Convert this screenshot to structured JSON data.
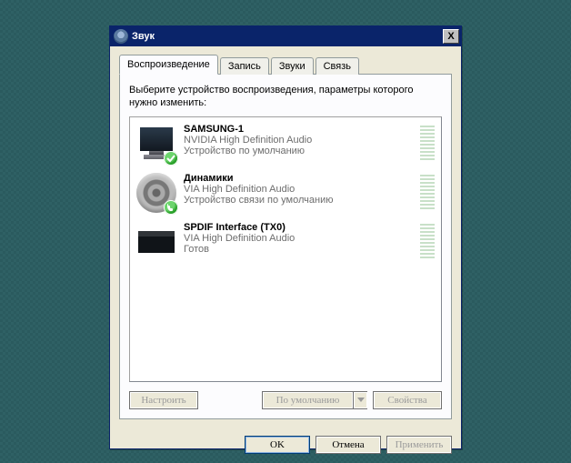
{
  "window": {
    "title": "Звук",
    "close": "X"
  },
  "tabs": {
    "active": 0,
    "items": [
      {
        "label": "Воспроизведение"
      },
      {
        "label": "Запись"
      },
      {
        "label": "Звуки"
      },
      {
        "label": "Связь"
      }
    ]
  },
  "instruction": "Выберите устройство воспроизведения, параметры которого нужно изменить:",
  "devices": [
    {
      "name": "SAMSUNG-1",
      "desc": "NVIDIA High Definition Audio",
      "status": "Устройство по умолчанию",
      "icon": "monitor",
      "badge": "check"
    },
    {
      "name": "Динамики",
      "desc": "VIA High Definition Audio",
      "status": "Устройство связи по умолчанию",
      "icon": "speaker",
      "badge": "phone"
    },
    {
      "name": "SPDIF Interface (TX0)",
      "desc": "VIA High Definition Audio",
      "status": "Готов",
      "icon": "spdif",
      "badge": "none"
    }
  ],
  "page_buttons": {
    "configure": "Настроить",
    "set_default": "По умолчанию",
    "properties": "Свойства"
  },
  "dialog_buttons": {
    "ok": "OK",
    "cancel": "Отмена",
    "apply": "Применить"
  }
}
